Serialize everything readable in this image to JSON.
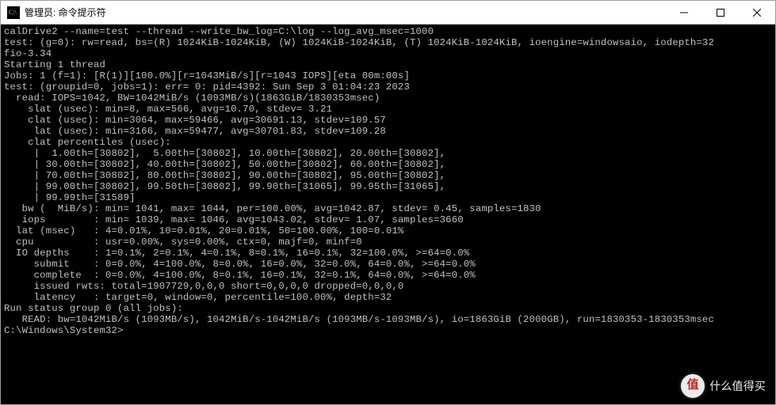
{
  "window": {
    "title": "管理员: 命令提示符"
  },
  "terminal": {
    "lines": [
      "calDrive2 --name=test --thread --write_bw_log=C:\\log --log_avg_msec=1000",
      "test: (g=0): rw=read, bs=(R) 1024KiB-1024KiB, (W) 1024KiB-1024KiB, (T) 1024KiB-1024KiB, ioengine=windowsaio, iodepth=32",
      "fio-3.34",
      "Starting 1 thread",
      "Jobs: 1 (f=1): [R(1)][100.0%][r=1043MiB/s][r=1043 IOPS][eta 00m:00s]",
      "test: (groupid=0, jobs=1): err= 0: pid=4392: Sun Sep 3 01:04:23 2023",
      "  read: IOPS=1042, BW=1042MiB/s (1093MB/s)(1863GiB/1830353msec)",
      "    slat (usec): min=8, max=566, avg=10.70, stdev= 3.21",
      "    clat (usec): min=3064, max=59466, avg=30691.13, stdev=109.57",
      "     lat (usec): min=3166, max=59477, avg=30701.83, stdev=109.28",
      "    clat percentiles (usec):",
      "     |  1.00th=[30802],  5.00th=[30802], 10.00th=[30802], 20.00th=[30802],",
      "     | 30.00th=[30802], 40.00th=[30802], 50.00th=[30802], 60.00th=[30802],",
      "     | 70.00th=[30802], 80.00th=[30802], 90.00th=[30802], 95.00th=[30802],",
      "     | 99.00th=[30802], 99.50th=[30802], 99.90th=[31065], 99.95th=[31065],",
      "     | 99.99th=[31589]",
      "   bw (  MiB/s): min= 1041, max= 1044, per=100.00%, avg=1042.87, stdev= 0.45, samples=1830",
      "   iops        : min= 1039, max= 1046, avg=1043.02, stdev= 1.07, samples=3660",
      "  lat (msec)   : 4=0.01%, 10=0.01%, 20=0.01%, 50=100.00%, 100=0.01%",
      "  cpu          : usr=0.00%, sys=0.00%, ctx=0, majf=0, minf=0",
      "  IO depths    : 1=0.1%, 2=0.1%, 4=0.1%, 8=0.1%, 16=0.1%, 32=100.0%, >=64=0.0%",
      "     submit    : 0=0.0%, 4=100.0%, 8=0.0%, 16=0.0%, 32=0.0%, 64=0.0%, >=64=0.0%",
      "     complete  : 0=0.0%, 4=100.0%, 8=0.1%, 16=0.1%, 32=0.1%, 64=0.0%, >=64=0.0%",
      "     issued rwts: total=1907729,0,0,0 short=0,0,0,0 dropped=0,0,0,0",
      "     latency   : target=0, window=0, percentile=100.00%, depth=32",
      "",
      "Run status group 0 (all jobs):",
      "   READ: bw=1042MiB/s (1093MB/s), 1042MiB/s-1042MiB/s (1093MB/s-1093MB/s), io=1863GiB (2000GB), run=1830353-1830353msec",
      "",
      "C:\\Windows\\System32>"
    ]
  },
  "watermark": {
    "badge": "值",
    "text": "什么值得买"
  }
}
